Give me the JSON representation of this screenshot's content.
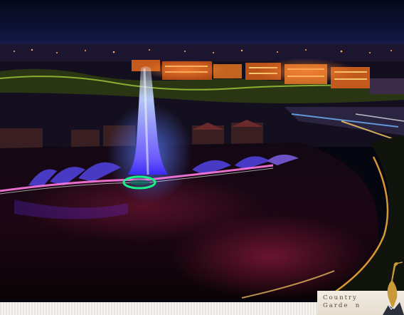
{
  "image": {
    "description_colors": {
      "sky_top": "#070b25",
      "sky_horizon": "#1a2050",
      "water": "#1a0716",
      "building_glow": "#ff7a2a",
      "fountain_core": "#c8d6ff",
      "fountain_purple": "#7b3dff",
      "ring_green": "#19f08a"
    }
  },
  "watermark": {
    "brand_line1": "Country",
    "brand_line2": "Garde  n"
  }
}
